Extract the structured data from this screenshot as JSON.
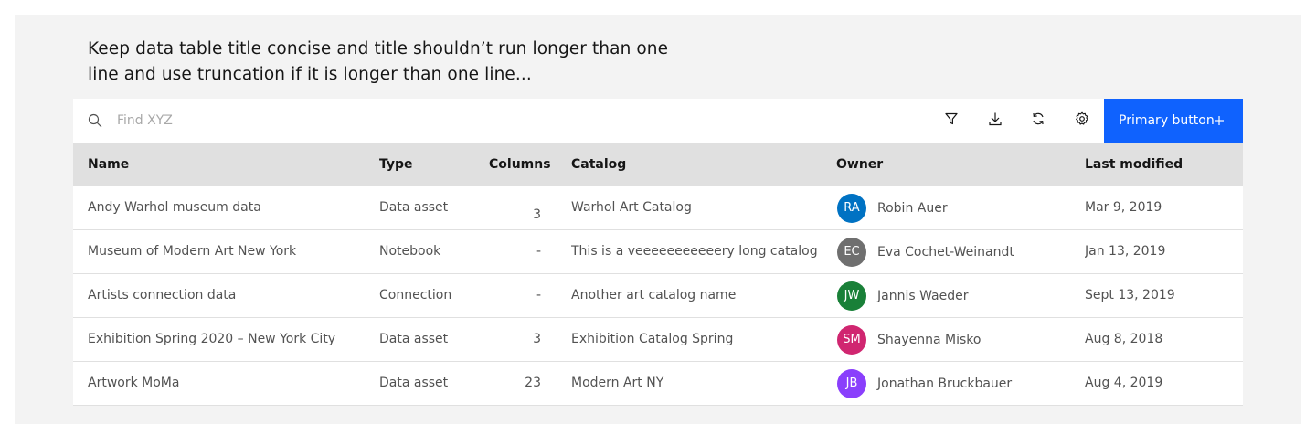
{
  "title": "Keep data table title concise and title shouldn’t run longer than one line and use truncation if it is longer than one line...",
  "toolbar": {
    "search_placeholder": "Find XYZ",
    "primary_button_label": "Primary button",
    "icons": [
      "search-icon",
      "filter-icon",
      "download-icon",
      "refresh-icon",
      "settings-icon",
      "add-icon"
    ]
  },
  "colors": {
    "primary": "#0f62fe",
    "header_bg": "#e0e0e0",
    "canvas_bg": "#f3f3f3"
  },
  "table": {
    "headers": {
      "name": "Name",
      "type": "Type",
      "columns": "Columns",
      "catalog": "Catalog",
      "owner": "Owner",
      "modified": "Last modified"
    },
    "rows": [
      {
        "name": "Andy Warhol museum data",
        "type": "Data asset",
        "columns": "3",
        "catalog": "Warhol Art Catalog",
        "initials": "RA",
        "owner": "Robin Auer",
        "avatar_color": "#0072c3",
        "modified": "Mar 9, 2019"
      },
      {
        "name": "Museum of Modern Art New York",
        "type": "Notebook",
        "columns": "-",
        "catalog": "This is a veeeeeeeeeeery long catalog n...",
        "initials": "EC",
        "owner": "Eva Cochet-Weinandt",
        "avatar_color": "#6f6f6f",
        "modified": "Jan 13, 2019"
      },
      {
        "name": "Artists connection data",
        "type": "Connection",
        "columns": "-",
        "catalog": "Another art catalog name",
        "initials": "JW",
        "owner": "Jannis Waeder",
        "avatar_color": "#198038",
        "modified": "Sept 13, 2019"
      },
      {
        "name": "Exhibition Spring 2020 – New York City",
        "type": "Data asset",
        "columns": "3",
        "catalog": "Exhibition Catalog Spring",
        "initials": "SM",
        "owner": "Shayenna Misko",
        "avatar_color": "#d02670",
        "modified": "Aug 8, 2018"
      },
      {
        "name": "Artwork MoMa",
        "type": "Data asset",
        "columns": "23",
        "catalog": "Modern Art NY",
        "initials": "JB",
        "owner": "Jonathan Bruckbauer",
        "avatar_color": "#8a3ffc",
        "modified": "Aug 4, 2019"
      }
    ]
  }
}
